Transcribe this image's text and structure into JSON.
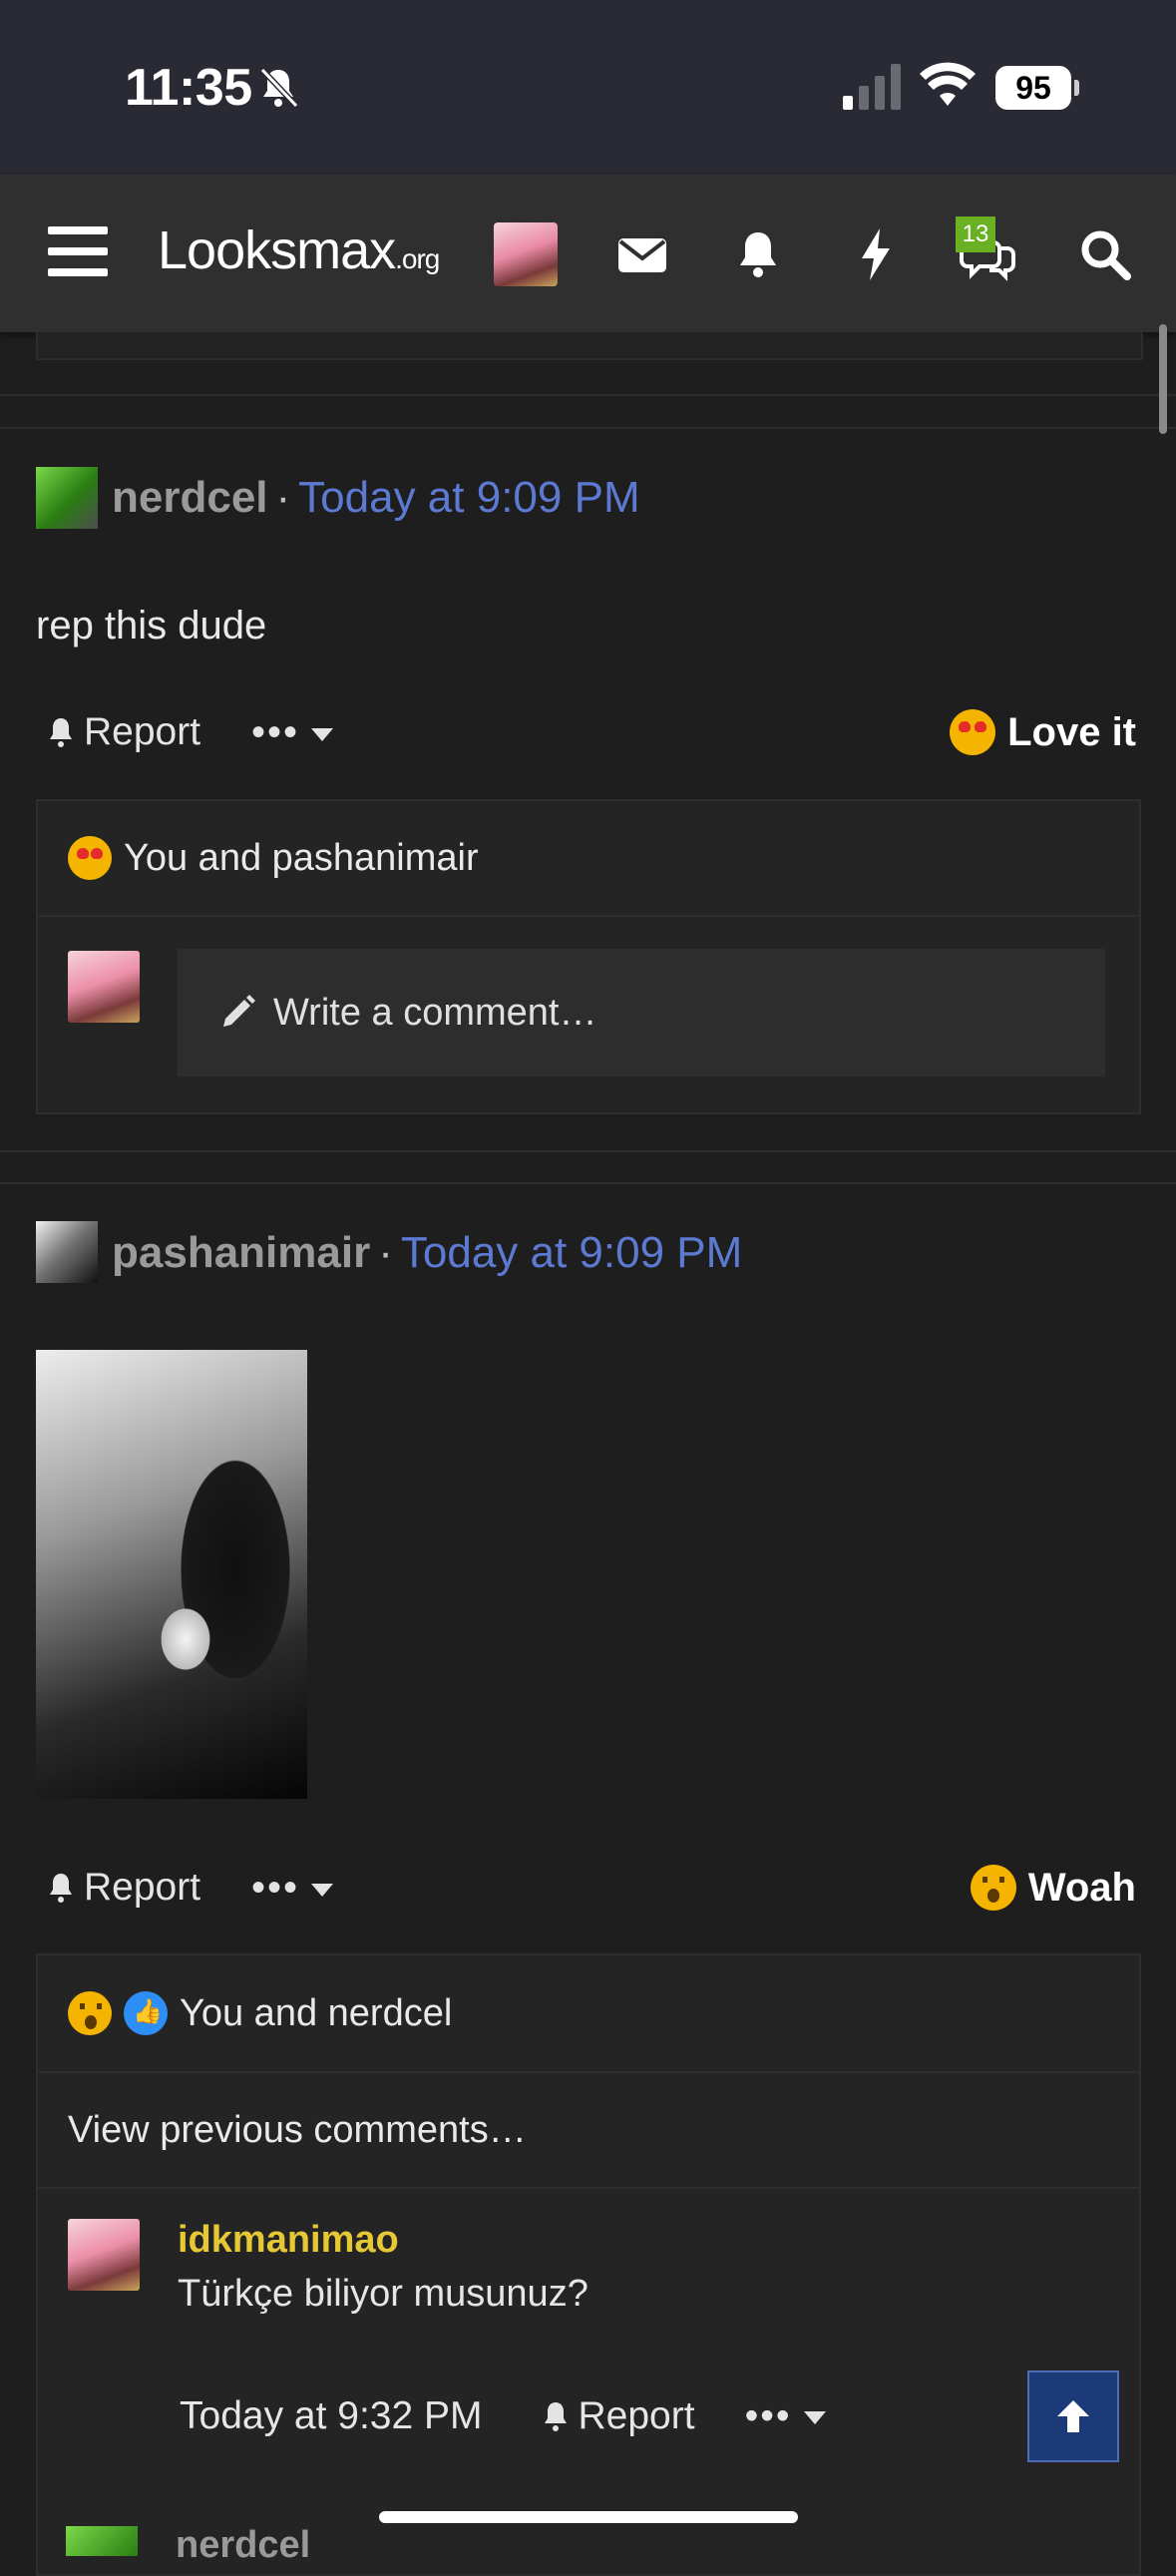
{
  "status_bar": {
    "time": "11:35",
    "battery": "95"
  },
  "nav": {
    "logo_main": "Looksmax",
    "logo_suffix": ".org",
    "messages_badge": "13"
  },
  "posts": [
    {
      "author": "nerdcel",
      "time": "Today at 9:09 PM",
      "text": "rep this dude",
      "report_label": "Report",
      "more_label": "•••",
      "reaction_label": "Love it",
      "reactors": "You and pashanimair",
      "comment_placeholder": "Write a comment…"
    },
    {
      "author": "pashanimair",
      "time": "Today at 9:09 PM",
      "report_label": "Report",
      "more_label": "•••",
      "reaction_label": "Woah",
      "reactors": "You and nerdcel",
      "view_previous": "View previous comments…",
      "comment": {
        "author": "idkmanimao",
        "text": "Türkçe biliyor musunuz?",
        "time": "Today at 9:32 PM",
        "report_label": "Report",
        "more_label": "•••"
      }
    }
  ],
  "partial_next": {
    "author": "nerdcel"
  },
  "colors": {
    "time_link": "#5d7ad3",
    "comment_author": "#e6c834",
    "badge": "#6ab023",
    "scroll_top": "#1c3a78"
  },
  "icons": [
    "bell-off-icon",
    "signal-icon",
    "wifi-icon",
    "menu-icon",
    "avatar",
    "mail-icon",
    "bell-icon",
    "bolt-icon",
    "chat-icon",
    "search-icon",
    "pencil-icon",
    "arrow-up-icon"
  ]
}
